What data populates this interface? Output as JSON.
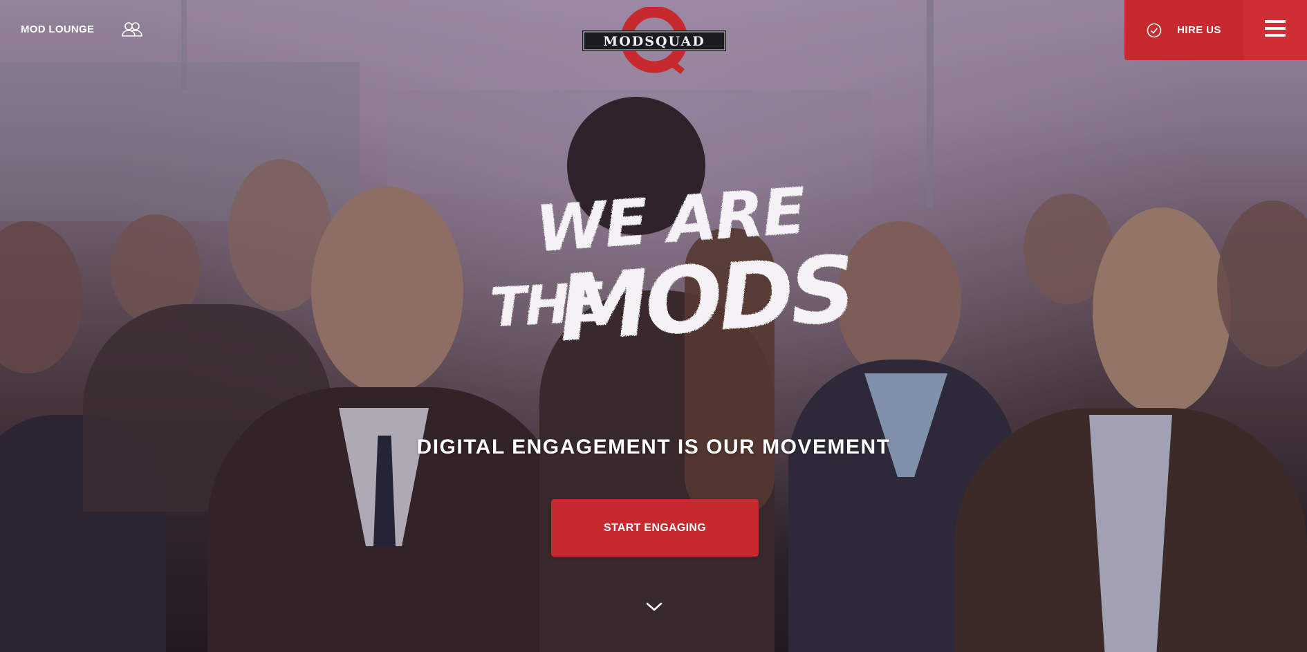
{
  "nav": {
    "lounge_label": "MOD LOUNGE",
    "lounge_icon": "people-icon",
    "hire_label": "HIRE US",
    "hire_icon": "checkmark-circle-icon",
    "menu_icon": "hamburger-menu-icon"
  },
  "logo": {
    "text": "MODSQUAD"
  },
  "hero": {
    "headline_line1": "WE ARE",
    "headline_line2a": "THE",
    "headline_line2b": "MODS",
    "tagline": "DIGITAL ENGAGEMENT IS OUR MOVEMENT",
    "cta_label": "START ENGAGING",
    "scroll_icon": "chevron-down-icon"
  },
  "colors": {
    "brand_red": "#c62a2f",
    "logo_dark": "#1b1c22",
    "text": "#ffffff"
  }
}
